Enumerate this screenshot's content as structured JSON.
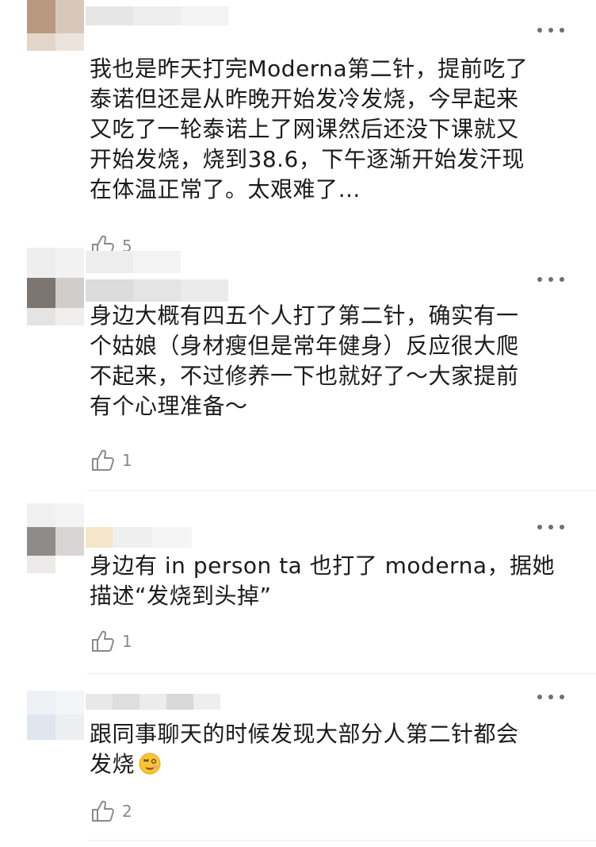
{
  "comments": [
    {
      "text": "我也是昨天打完Moderna第二针，提前吃了\n泰诺但还是从昨晚开始发冷发烧，今早起来\n又吃了一轮泰诺上了网课然后还没下课就又\n开始发烧，烧到38.6，下午逐渐开始发汗现\n在体温正常了。太艰难了…",
      "likes": "5"
    },
    {
      "text": "身边大概有四五个人打了第二针，确实有一\n个姑娘（身材瘦但是常年健身）反应很大爬\n不起来，不过修养一下也就好了～大家提前\n有个心理准备～",
      "likes": "1"
    },
    {
      "text": "身边有 in person ta 也打了 moderna，据她\n描述“发烧到头掉”",
      "likes": "1"
    },
    {
      "text": "跟同事聊天的时候发现大部分人第二针都会\n发烧",
      "likes": "2"
    }
  ],
  "icons": {
    "more": "more-dots-icon",
    "like": "thumbs-up-icon",
    "emoji": "dizzy-face-emoji-icon"
  },
  "colors": {
    "text": "#1b1b1b",
    "meta": "#8a8a8a",
    "divider": "#ececec",
    "dots": "#6f6f6f"
  }
}
